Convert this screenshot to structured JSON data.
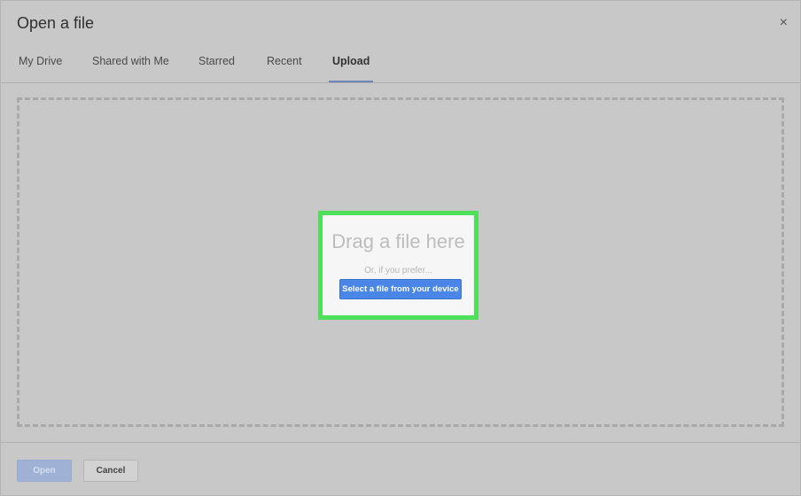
{
  "dialog": {
    "title": "Open a file",
    "close_glyph": "×"
  },
  "tabs": [
    {
      "label": "My Drive",
      "active": false
    },
    {
      "label": "Shared with Me",
      "active": false
    },
    {
      "label": "Starred",
      "active": false
    },
    {
      "label": "Recent",
      "active": false
    },
    {
      "label": "Upload",
      "active": true
    }
  ],
  "upload": {
    "drag_text": "Drag a file here",
    "or_text": "Or, if you prefer...",
    "select_button": "Select a file from your device"
  },
  "footer": {
    "open_label": "Open",
    "cancel_label": "Cancel"
  },
  "colors": {
    "primary_button": "#4a86e8",
    "highlight_border": "#4ee05a",
    "active_tab_underline": "#6d86b5"
  }
}
